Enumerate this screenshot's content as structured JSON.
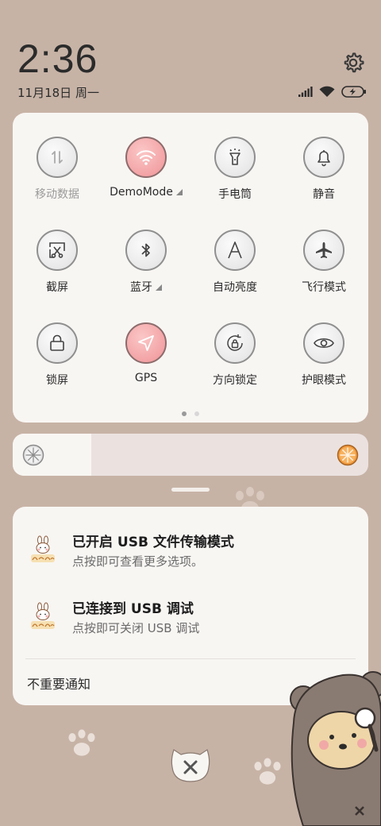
{
  "status": {
    "time": "2:36",
    "date": "11月18日 周一"
  },
  "quick_settings": {
    "tiles": [
      {
        "label": "移动数据",
        "icon": "mobile-data-icon",
        "state": "disabled"
      },
      {
        "label": "DemoMode",
        "icon": "wifi-icon",
        "state": "on",
        "expandable": true
      },
      {
        "label": "手电筒",
        "icon": "flashlight-icon",
        "state": "off"
      },
      {
        "label": "静音",
        "icon": "bell-icon",
        "state": "off"
      },
      {
        "label": "截屏",
        "icon": "screenshot-icon",
        "state": "off"
      },
      {
        "label": "蓝牙",
        "icon": "bluetooth-icon",
        "state": "off",
        "expandable": true
      },
      {
        "label": "自动亮度",
        "icon": "auto-brightness-icon",
        "state": "off"
      },
      {
        "label": "飞行模式",
        "icon": "airplane-icon",
        "state": "off"
      },
      {
        "label": "锁屏",
        "icon": "lock-icon",
        "state": "off"
      },
      {
        "label": "GPS",
        "icon": "location-icon",
        "state": "on"
      },
      {
        "label": "方向锁定",
        "icon": "rotation-lock-icon",
        "state": "off"
      },
      {
        "label": "护眼模式",
        "icon": "eye-icon",
        "state": "off"
      }
    ],
    "pages": 2,
    "current_page": 1
  },
  "brightness": {
    "level_fraction": 0.22
  },
  "notifications": [
    {
      "title": "已开启 USB 文件传输模式",
      "text": "点按即可查看更多选项。",
      "icon": "lucky-bunny-icon"
    },
    {
      "title": "已连接到 USB 调试",
      "text": "点按即可关闭 USB 调试",
      "icon": "lucky-bunny-icon"
    }
  ],
  "unimportant_label": "不重要通知",
  "colors": {
    "wallpaper": "#c7b3a6",
    "panel": "#f8f6f3",
    "tile_on": "#f3a3a5",
    "tile_off": "#e9e9e9"
  }
}
